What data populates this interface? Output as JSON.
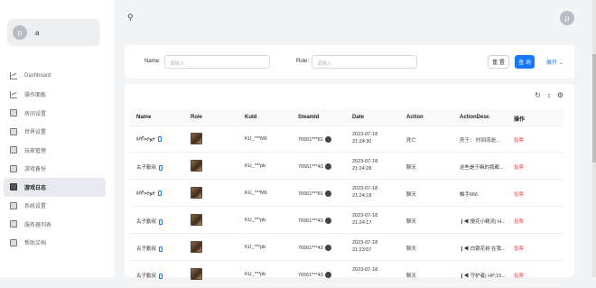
{
  "user": {
    "avatar_letter": "p",
    "name": "a"
  },
  "menu": [
    {
      "label": "Dashboard",
      "icon": "chart-icon"
    },
    {
      "label": "操作面板",
      "icon": "chart-icon"
    },
    {
      "label": "房间设置",
      "icon": "box-icon"
    },
    {
      "label": "世界设置",
      "icon": "box-icon"
    },
    {
      "label": "玩家管理",
      "icon": "box-icon"
    },
    {
      "label": "游戏备份",
      "icon": "box-icon"
    },
    {
      "label": "游戏日志",
      "icon": "box-icon",
      "active": true
    },
    {
      "label": "系统设置",
      "icon": "box-icon"
    },
    {
      "label": "服务器列表",
      "icon": "box-icon"
    },
    {
      "label": "帮助文档",
      "icon": "box-icon"
    }
  ],
  "topbar": {
    "avatar_letter": "p"
  },
  "filter": {
    "name_label": "Name:",
    "name_placeholder": "请输入",
    "role_label": "Role:",
    "role_placeholder": "请输入",
    "reset_label": "重 置",
    "query_label": "查 询",
    "expand_label": "展开"
  },
  "table": {
    "columns": [
      "Name",
      "Role",
      "KuId",
      "SteamId",
      "Date",
      "Action",
      "ActionDesc",
      "操作"
    ],
    "rows": [
      {
        "name": "𝑀𝒪𝓃𝑒𝓎𝑒",
        "phone": true,
        "kuid": "KU_***M6",
        "steamid": "76561***81",
        "date1": "2023-07-18",
        "date2": "21:24:30",
        "action": "死亡",
        "desc": "死于：  时间流逝...",
        "op": "投票"
      },
      {
        "name": "古子勤叔",
        "phone": true,
        "kuid": "KU_***pb",
        "steamid": "76561***43",
        "date1": "2023-07-18",
        "date2": "21:24:28",
        "action": "聊天",
        "desc": "这些是干嘛的我都...",
        "op": "投票"
      },
      {
        "name": "𝑀𝒪𝓃𝑒𝓎𝑒",
        "phone": true,
        "kuid": "KU_***M6",
        "steamid": "76561***81",
        "date1": "2023-07-18",
        "date2": "21:24:18",
        "action": "聊天",
        "desc": "触手666",
        "op": "投票"
      },
      {
        "name": "古子勤叔",
        "phone": true,
        "kuid": "KU_***pb",
        "steamid": "76561***43",
        "date1": "2023-07-18",
        "date2": "21:24:17",
        "action": "聊天",
        "desc": "❙◀ 慢花小精灵| H...",
        "op": "投票"
      },
      {
        "name": "古子勤叔",
        "phone": true,
        "kuid": "KU_***pb",
        "steamid": "76561***43",
        "date1": "2023-07-18",
        "date2": "21:23:07",
        "action": "聊天",
        "desc": "❙◀ 白银花树 在我...",
        "op": "投票"
      },
      {
        "name": "古子勤叔",
        "phone": true,
        "kuid": "KU_***pb",
        "steamid": "76561***43",
        "date1": "2023-07-18",
        "date2": "",
        "action": "聊天",
        "desc": "❙◀ 守护者| HP:15...",
        "op": "投票"
      }
    ]
  }
}
